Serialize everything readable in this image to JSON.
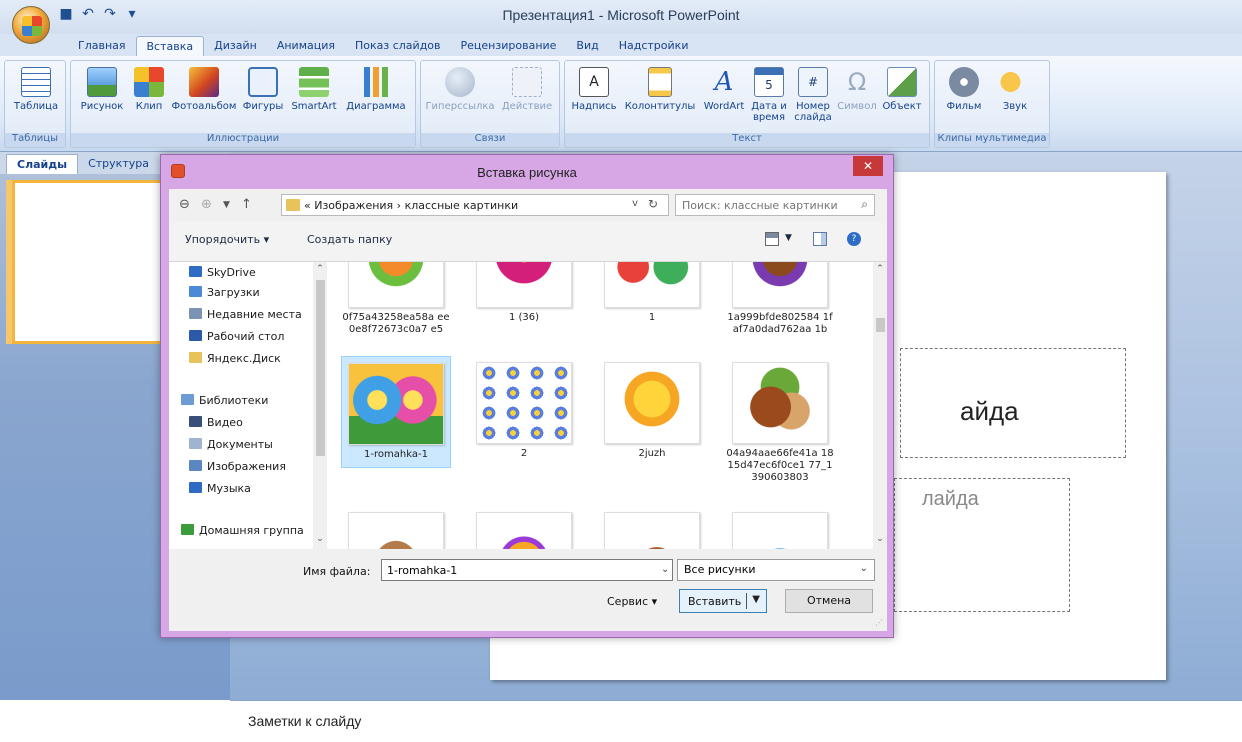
{
  "app": {
    "title": "Презентация1 - Microsoft PowerPoint",
    "qat_icons": [
      "save-icon",
      "undo-icon",
      "redo-icon",
      "customize-arrow-icon"
    ]
  },
  "ribbon": {
    "tabs": [
      "Главная",
      "Вставка",
      "Дизайн",
      "Анимация",
      "Показ слайдов",
      "Рецензирование",
      "Вид",
      "Надстройки"
    ],
    "active_tab": "Вставка",
    "groups": {
      "tables": {
        "label": "Таблицы",
        "buttons": [
          "Таблица"
        ]
      },
      "illustrations": {
        "label": "Иллюстрации",
        "buttons": [
          "Рисунок",
          "Клип",
          "Фотоальбом",
          "Фигуры",
          "SmartArt",
          "Диаграмма"
        ]
      },
      "links": {
        "label": "Связи",
        "buttons": [
          "Гиперссылка",
          "Действие"
        ]
      },
      "text": {
        "label": "Текст",
        "buttons": [
          "Надпись",
          "Колонтитулы",
          "WordArt",
          "Дата и время",
          "Номер слайда",
          "Символ",
          "Объект"
        ]
      },
      "media": {
        "label": "Клипы мультимедиа",
        "buttons": [
          "Фильм",
          "Звук"
        ]
      }
    }
  },
  "left_pane": {
    "tabs": [
      "Слайды",
      "Структура"
    ],
    "active_tab": "Слайды",
    "slide_number": "1"
  },
  "slide": {
    "title_placeholder": "айда",
    "subtitle_placeholder": "лайда"
  },
  "notes": {
    "placeholder": "Заметки к слайду"
  },
  "dialog": {
    "title": "Вставка рисунка",
    "address": {
      "path": "« Изображения › классные картинки",
      "search_placeholder": "Поиск: классные картинки"
    },
    "toolbar": {
      "organize": "Упорядочить ▾",
      "new_folder": "Создать папку"
    },
    "nav": {
      "items": [
        {
          "label": "SkyDrive",
          "icon": "skydrive-icon",
          "color": "#2e6dc6"
        },
        {
          "label": "Загрузки",
          "icon": "downloads-folder-icon",
          "color": "#4b8ad6"
        },
        {
          "label": "Недавние места",
          "icon": "recent-places-icon",
          "color": "#7d93b3"
        },
        {
          "label": "Рабочий стол",
          "icon": "desktop-icon",
          "color": "#2a5aa8"
        },
        {
          "label": "Яндекс.Диск",
          "icon": "yandex-disk-folder-icon",
          "color": "#e8c25a"
        },
        {
          "label": "Библиотеки",
          "icon": "libraries-icon",
          "color": "#6d9bd6"
        },
        {
          "label": "Видео",
          "icon": "video-library-icon",
          "color": "#3a4e7a"
        },
        {
          "label": "Документы",
          "icon": "documents-library-icon",
          "color": "#9fb4d1"
        },
        {
          "label": "Изображения",
          "icon": "pictures-library-icon",
          "color": "#5a86c3"
        },
        {
          "label": "Музыка",
          "icon": "music-library-icon",
          "color": "#2f6bc4"
        },
        {
          "label": "Домашняя группа",
          "icon": "homegroup-icon",
          "color": "#3b9c3b"
        }
      ]
    },
    "files": [
      {
        "caption": "0f75a43258ea58a ee0e8f72673c0a7 e5",
        "picture": "fruit-cartoon"
      },
      {
        "caption": "1 (36)",
        "picture": "pink-flower"
      },
      {
        "caption": "1",
        "picture": "crab-and-turtle"
      },
      {
        "caption": "1a999bfde802584 1faf7a0dad762aa 1b",
        "picture": "monkey-cartoon"
      },
      {
        "caption": "1-romahka-1",
        "picture": "smiling-flowers",
        "selected": true
      },
      {
        "caption": "2",
        "picture": "flower-pattern"
      },
      {
        "caption": "2juzh",
        "picture": "smiling-sun"
      },
      {
        "caption": "04a94aae66fe41a 1815d47ec6f0ce1 77_1390603803",
        "picture": "hazelnuts"
      },
      {
        "caption": "",
        "picture": "bunny"
      },
      {
        "caption": "",
        "picture": "fish-cartoon"
      },
      {
        "caption": "",
        "picture": "squirrel"
      },
      {
        "caption": "",
        "picture": "castle"
      }
    ],
    "file_name_label": "Имя файла:",
    "file_name_value": "1-romahka-1",
    "file_type": "Все рисунки",
    "tools_label": "Сервис",
    "insert_label": "Вставить",
    "cancel_label": "Отмена"
  },
  "colors": {
    "accent": "#15428b",
    "dialog_frame": "#d7a6e4",
    "close_button": "#c7383b",
    "selection": "#cce8ff"
  }
}
